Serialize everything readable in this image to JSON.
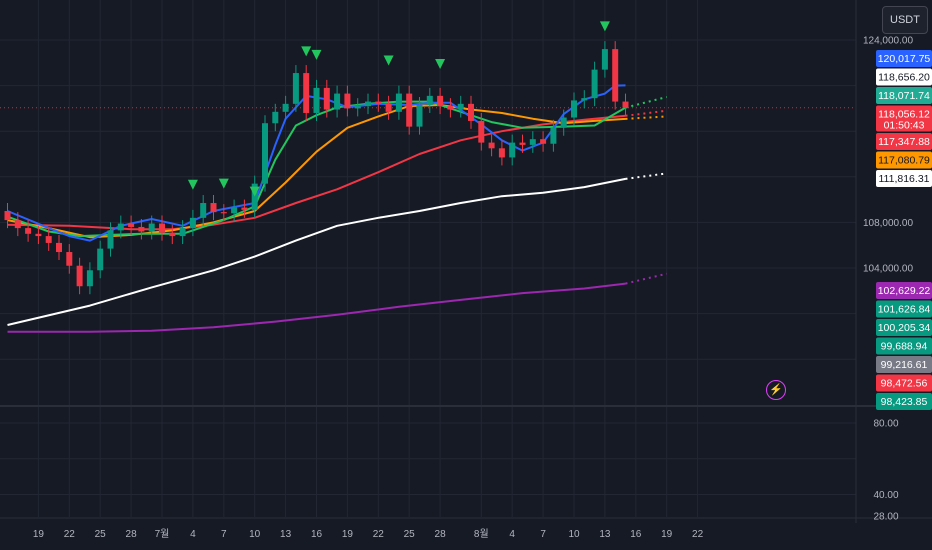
{
  "toolbar": {
    "currency_label": "USDT"
  },
  "icons": {
    "alert": "lightning-alert-icon"
  },
  "chart_data": [
    {
      "type": "line",
      "title": "",
      "price_axis": {
        "ylim": [
          97500,
          125300
        ],
        "labels": [
          {
            "value": 124000,
            "text": "124,000.00"
          },
          {
            "value": 108000,
            "text": "108,000.00"
          },
          {
            "value": 104000,
            "text": "104,000.00"
          }
        ]
      },
      "x_axis": {
        "labels": [
          {
            "day": 19,
            "text": "19"
          },
          {
            "day": 22,
            "text": "22"
          },
          {
            "day": 25,
            "text": "25"
          },
          {
            "day": 28,
            "text": "28"
          },
          {
            "day": 31,
            "text": "7월"
          },
          {
            "day": 34,
            "text": "4"
          },
          {
            "day": 37,
            "text": "7"
          },
          {
            "day": 40,
            "text": "10"
          },
          {
            "day": 43,
            "text": "13"
          },
          {
            "day": 46,
            "text": "16"
          },
          {
            "day": 49,
            "text": "19"
          },
          {
            "day": 52,
            "text": "22"
          },
          {
            "day": 55,
            "text": "25"
          },
          {
            "day": 58,
            "text": "28"
          },
          {
            "day": 62,
            "text": "8월"
          },
          {
            "day": 65,
            "text": "4"
          },
          {
            "day": 68,
            "text": "7"
          },
          {
            "day": 71,
            "text": "10"
          },
          {
            "day": 74,
            "text": "13"
          },
          {
            "day": 77,
            "text": "16"
          },
          {
            "day": 80,
            "text": "19"
          },
          {
            "day": 83,
            "text": "22"
          }
        ]
      },
      "series": [
        {
          "color": "#ffffff",
          "values": [
            [
              16,
              99000
            ],
            [
              24,
              100700
            ],
            [
              30,
              102300
            ],
            [
              36,
              103800
            ],
            [
              40,
              105000
            ],
            [
              44,
              106400
            ],
            [
              48,
              107700
            ],
            [
              52,
              108400
            ],
            [
              56,
              109000
            ],
            [
              60,
              109700
            ],
            [
              64,
              110300
            ],
            [
              68,
              110600
            ],
            [
              72,
              111100
            ],
            [
              76,
              111816
            ],
            [
              80,
              112300
            ]
          ]
        },
        {
          "color": "#9c27b0",
          "values": [
            [
              16,
              98400
            ],
            [
              24,
              98400
            ],
            [
              30,
              98500
            ],
            [
              36,
              98800
            ],
            [
              42,
              99300
            ],
            [
              48,
              99900
            ],
            [
              54,
              100600
            ],
            [
              60,
              101200
            ],
            [
              66,
              101800
            ],
            [
              72,
              102200
            ],
            [
              76,
              102629
            ],
            [
              80,
              103500
            ]
          ]
        },
        {
          "color": "#f23645",
          "values": [
            [
              16,
              107800
            ],
            [
              22,
              107700
            ],
            [
              28,
              107400
            ],
            [
              32,
              107400
            ],
            [
              36,
              107800
            ],
            [
              40,
              108400
            ],
            [
              44,
              109700
            ],
            [
              48,
              110900
            ],
            [
              52,
              112400
            ],
            [
              56,
              114000
            ],
            [
              60,
              115200
            ],
            [
              64,
              116000
            ],
            [
              68,
              116600
            ],
            [
              72,
              117000
            ],
            [
              76,
              117348
            ],
            [
              80,
              117800
            ]
          ]
        },
        {
          "color": "#ff9800",
          "values": [
            [
              16,
              108200
            ],
            [
              20,
              107500
            ],
            [
              24,
              106700
            ],
            [
              28,
              106900
            ],
            [
              32,
              107300
            ],
            [
              36,
              108000
            ],
            [
              40,
              109000
            ],
            [
              43,
              111500
            ],
            [
              46,
              114200
            ],
            [
              49,
              116300
            ],
            [
              52,
              117300
            ],
            [
              55,
              118200
            ],
            [
              58,
              118300
            ],
            [
              61,
              117900
            ],
            [
              64,
              117600
            ],
            [
              67,
              117100
            ],
            [
              70,
              116700
            ],
            [
              73,
              116900
            ],
            [
              76,
              117081
            ],
            [
              80,
              117300
            ]
          ]
        },
        {
          "color": "#22c55e",
          "values": [
            [
              16,
              108500
            ],
            [
              20,
              107200
            ],
            [
              23,
              106800
            ],
            [
              26,
              106900
            ],
            [
              29,
              107000
            ],
            [
              33,
              107000
            ],
            [
              37,
              108200
            ],
            [
              40,
              109400
            ],
            [
              42,
              113500
            ],
            [
              44,
              116500
            ],
            [
              46,
              117400
            ],
            [
              48,
              118100
            ],
            [
              51,
              118400
            ],
            [
              54,
              118600
            ],
            [
              57,
              118600
            ],
            [
              60,
              117700
            ],
            [
              63,
              116800
            ],
            [
              66,
              116300
            ],
            [
              70,
              116400
            ],
            [
              73,
              116500
            ],
            [
              76,
              118072
            ],
            [
              80,
              119000
            ]
          ]
        },
        {
          "color": "#2962ff",
          "values": [
            [
              16,
              109000
            ],
            [
              20,
              107500
            ],
            [
              22,
              106800
            ],
            [
              24,
              106400
            ],
            [
              27,
              107700
            ],
            [
              30,
              108300
            ],
            [
              33,
              107700
            ],
            [
              36,
              109000
            ],
            [
              40,
              109700
            ],
            [
              42,
              114800
            ],
            [
              43,
              117100
            ],
            [
              45,
              119100
            ],
            [
              47,
              118800
            ],
            [
              49,
              118100
            ],
            [
              52,
              118400
            ],
            [
              55,
              118300
            ],
            [
              57,
              118500
            ],
            [
              59,
              118500
            ],
            [
              62,
              116600
            ],
            [
              64,
              115200
            ],
            [
              66,
              114300
            ],
            [
              68,
              115000
            ],
            [
              70,
              117500
            ],
            [
              72,
              118800
            ],
            [
              74,
              119300
            ],
            [
              75,
              120000
            ],
            [
              76,
              120018
            ]
          ]
        }
      ],
      "candles": [
        [
          16,
          109000,
          108200
        ],
        [
          17,
          108200,
          107500
        ],
        [
          18,
          107500,
          107000
        ],
        [
          19,
          107000,
          106800
        ],
        [
          20,
          106800,
          106200
        ],
        [
          21,
          106200,
          105400
        ],
        [
          22,
          105400,
          104200
        ],
        [
          23,
          104200,
          102400
        ],
        [
          24,
          102400,
          103800
        ],
        [
          25,
          103800,
          105700
        ],
        [
          26,
          105700,
          107300
        ],
        [
          27,
          107300,
          107900
        ],
        [
          28,
          107900,
          107600
        ],
        [
          29,
          107600,
          107200
        ],
        [
          30,
          107200,
          107900
        ],
        [
          31,
          107900,
          107100
        ],
        [
          32,
          107100,
          106800
        ],
        [
          33,
          106800,
          107500
        ],
        [
          34,
          107500,
          108400
        ],
        [
          35,
          108400,
          109700
        ],
        [
          36,
          109700,
          108900
        ],
        [
          37,
          108900,
          108800
        ],
        [
          38,
          108800,
          109300
        ],
        [
          39,
          109300,
          109100
        ],
        [
          40,
          109100,
          111400
        ],
        [
          41,
          111400,
          116700
        ],
        [
          42,
          116700,
          117700
        ],
        [
          43,
          117700,
          118400
        ],
        [
          44,
          118400,
          121100
        ],
        [
          45,
          121100,
          117600
        ],
        [
          46,
          117600,
          119800
        ],
        [
          47,
          119800,
          117900
        ],
        [
          48,
          117900,
          119300
        ],
        [
          49,
          119300,
          118000
        ],
        [
          50,
          118000,
          118200
        ],
        [
          51,
          118200,
          118600
        ],
        [
          52,
          118600,
          118400
        ],
        [
          53,
          118400,
          117700
        ],
        [
          54,
          117700,
          119300
        ],
        [
          55,
          119300,
          116400
        ],
        [
          56,
          116400,
          118300
        ],
        [
          57,
          118300,
          119100
        ],
        [
          58,
          119100,
          118200
        ],
        [
          59,
          118200,
          117900
        ],
        [
          60,
          117900,
          118400
        ],
        [
          61,
          118400,
          116900
        ],
        [
          62,
          116900,
          115000
        ],
        [
          63,
          115000,
          114500
        ],
        [
          64,
          114500,
          113700
        ],
        [
          65,
          113700,
          115000
        ],
        [
          66,
          115000,
          114800
        ],
        [
          67,
          114800,
          115300
        ],
        [
          68,
          115300,
          114900
        ],
        [
          69,
          114900,
          116300
        ],
        [
          70,
          116300,
          117200
        ],
        [
          71,
          117200,
          118700
        ],
        [
          72,
          118700,
          118900
        ],
        [
          73,
          118900,
          121400
        ],
        [
          74,
          121400,
          123200
        ],
        [
          75,
          123200,
          118600
        ],
        [
          76,
          118600,
          118056
        ]
      ],
      "markers": [
        {
          "day": 34,
          "value": 111300
        },
        {
          "day": 37,
          "value": 111400
        },
        {
          "day": 40,
          "value": 110700
        },
        {
          "day": 45,
          "value": 123000
        },
        {
          "day": 46,
          "value": 122700
        },
        {
          "day": 53,
          "value": 122200
        },
        {
          "day": 58,
          "value": 121900
        },
        {
          "day": 74,
          "value": 125200
        }
      ],
      "price_tags": [
        {
          "text": "120,017.75",
          "bg": "#2962ff",
          "fg": "#ffffff"
        },
        {
          "text": "118,656.20",
          "bg": "#ffffff",
          "fg": "#131722"
        },
        {
          "text": "118,071.74",
          "bg": "#22ab94",
          "fg": "#ffffff"
        },
        {
          "text": "118,056.12",
          "bg": "#f23645",
          "fg": "#ffffff",
          "sub": "01:50:43"
        },
        {
          "text": "117,347.88",
          "bg": "#f23645",
          "fg": "#ffffff"
        },
        {
          "text": "117,080.79",
          "bg": "#ff9800",
          "fg": "#131722"
        },
        {
          "text": "111,816.31",
          "bg": "#ffffff",
          "fg": "#131722"
        },
        {
          "text": "102,629.22",
          "bg": "#9c27b0",
          "fg": "#ffffff"
        },
        {
          "text": "101,626.84",
          "bg": "#089981",
          "fg": "#ffffff"
        },
        {
          "text": "100,205.34",
          "bg": "#089981",
          "fg": "#ffffff"
        },
        {
          "text": "99,688.94",
          "bg": "#089981",
          "fg": "#ffffff"
        },
        {
          "text": "99,216.61",
          "bg": "#787b86",
          "fg": "#ffffff"
        },
        {
          "text": "98,472.56",
          "bg": "#f23645",
          "fg": "#ffffff"
        },
        {
          "text": "98,423.85",
          "bg": "#089981",
          "fg": "#ffffff"
        }
      ]
    },
    {
      "type": "line",
      "title": "",
      "ylim": [
        25,
        83
      ],
      "axis_labels": [
        {
          "value": 80,
          "text": "80.00"
        },
        {
          "value": 40,
          "text": "40.00"
        },
        {
          "value": 28,
          "text": "28.00"
        }
      ]
    }
  ]
}
